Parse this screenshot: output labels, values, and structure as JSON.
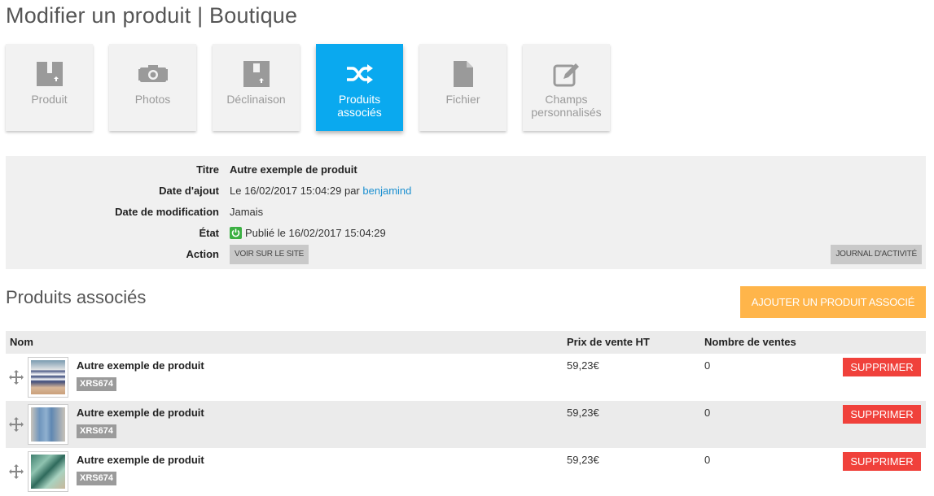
{
  "page": {
    "title": "Modifier un produit | Boutique"
  },
  "tabs": [
    {
      "label": "Produit",
      "icon": "box-icon",
      "active": false
    },
    {
      "label": "Photos",
      "icon": "camera-icon",
      "active": false
    },
    {
      "label": "Déclinaison",
      "icon": "variant-box-icon",
      "active": false
    },
    {
      "label": "Produits\nassociés",
      "icon": "shuffle-icon",
      "active": true
    },
    {
      "label": "Fichier",
      "icon": "file-icon",
      "active": false
    },
    {
      "label": "Champs\npersonnalisés",
      "icon": "edit-icon",
      "active": false
    }
  ],
  "info": {
    "title_label": "Titre",
    "title_value": "Autre exemple de produit",
    "added_label": "Date d'ajout",
    "added_value": "Le 16/02/2017 15:04:29 par",
    "added_user": "benjamind",
    "modified_label": "Date de modification",
    "modified_value": "Jamais",
    "state_label": "État",
    "state_value": "Publié le 16/02/2017 15:04:29",
    "action_label": "Action",
    "view_site_button": "Voir sur le site",
    "activity_log_button": "Journal d'activité"
  },
  "section": {
    "title": "Produits associés",
    "add_button": "Ajouter un produit associé"
  },
  "table": {
    "headers": {
      "name": "Nom",
      "price": "Prix de vente HT",
      "sales": "Nombre de ventes"
    },
    "rows": [
      {
        "name": "Autre exemple de produit",
        "ref": "XRS674",
        "price": "59,23€",
        "sales": "0",
        "delete": "Supprimer"
      },
      {
        "name": "Autre exemple de produit",
        "ref": "XRS674",
        "price": "59,23€",
        "sales": "0",
        "delete": "Supprimer"
      },
      {
        "name": "Autre exemple de produit",
        "ref": "XRS674",
        "price": "59,23€",
        "sales": "0",
        "delete": "Supprimer"
      }
    ]
  },
  "colors": {
    "accent": "#0aa9ef",
    "warning": "#ffb54a",
    "danger": "#f0413b",
    "success": "#3cb043"
  }
}
